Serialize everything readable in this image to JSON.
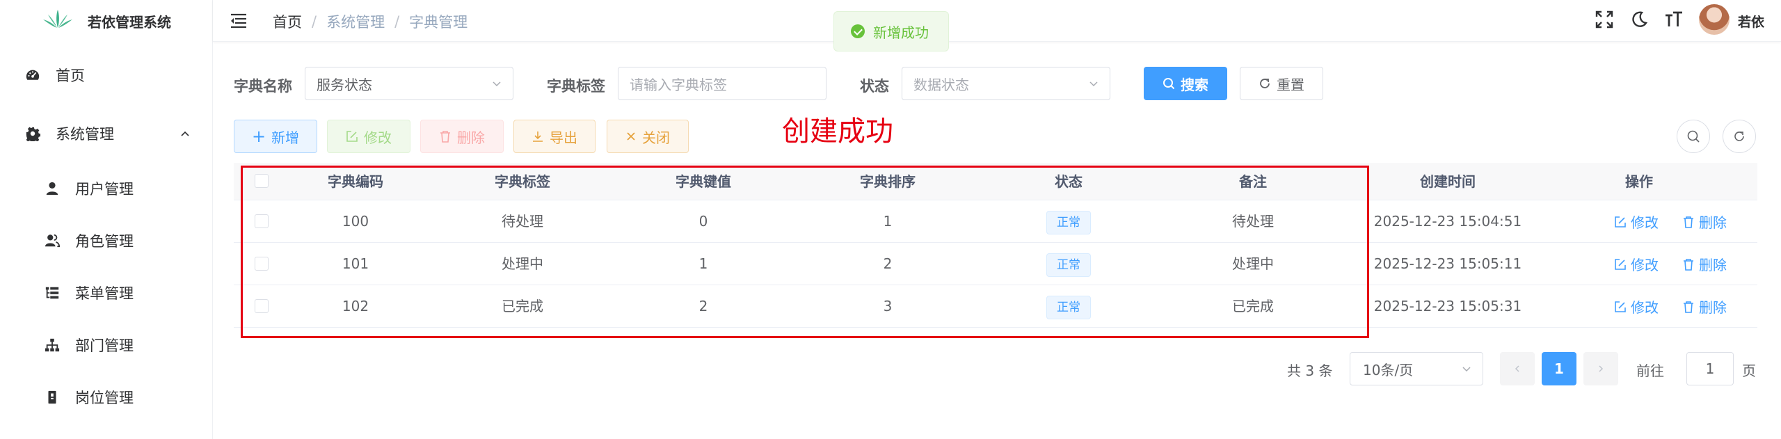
{
  "app": {
    "title": "若依管理系统"
  },
  "sidebar": {
    "items": [
      {
        "label": "首页",
        "icon": "dashboard-icon"
      },
      {
        "label": "系统管理",
        "icon": "gear-icon",
        "expanded": true
      }
    ],
    "subitems": [
      {
        "label": "用户管理",
        "icon": "user-icon"
      },
      {
        "label": "角色管理",
        "icon": "peoples-icon"
      },
      {
        "label": "菜单管理",
        "icon": "tree-table-icon"
      },
      {
        "label": "部门管理",
        "icon": "tree-icon"
      },
      {
        "label": "岗位管理",
        "icon": "post-icon"
      }
    ]
  },
  "navbar": {
    "breadcrumb": [
      "首页",
      "系统管理",
      "字典管理"
    ],
    "username": "若依"
  },
  "toast": {
    "message": "新增成功"
  },
  "search": {
    "dict_name_label": "字典名称",
    "dict_name_value": "服务状态",
    "dict_label_label": "字典标签",
    "dict_label_placeholder": "请输入字典标签",
    "status_label": "状态",
    "status_placeholder": "数据状态",
    "search_button": "搜索",
    "reset_button": "重置"
  },
  "toolbar": {
    "add": "新增",
    "edit": "修改",
    "delete": "删除",
    "export": "导出",
    "close": "关闭"
  },
  "annotation": "创建成功",
  "table": {
    "columns": [
      "字典编码",
      "字典标签",
      "字典键值",
      "字典排序",
      "状态",
      "备注",
      "创建时间",
      "操作"
    ],
    "rows": [
      {
        "code": "100",
        "label": "待处理",
        "value": "0",
        "sort": "1",
        "status": "正常",
        "remark": "待处理",
        "created": "2025-12-23 15:04:51"
      },
      {
        "code": "101",
        "label": "处理中",
        "value": "1",
        "sort": "2",
        "status": "正常",
        "remark": "处理中",
        "created": "2025-12-23 15:05:11"
      },
      {
        "code": "102",
        "label": "已完成",
        "value": "2",
        "sort": "3",
        "status": "正常",
        "remark": "已完成",
        "created": "2025-12-23 15:05:31"
      }
    ],
    "row_edit": "修改",
    "row_delete": "删除"
  },
  "pagination": {
    "total": "共 3 条",
    "page_size": "10条/页",
    "current": "1",
    "goto_label": "前往",
    "goto_value": "1",
    "page_suffix": "页"
  },
  "colors": {
    "primary": "#409eff",
    "success": "#67c23a",
    "warning": "#e6a23c",
    "danger": "#f56c6c",
    "annotation": "#e60012"
  }
}
